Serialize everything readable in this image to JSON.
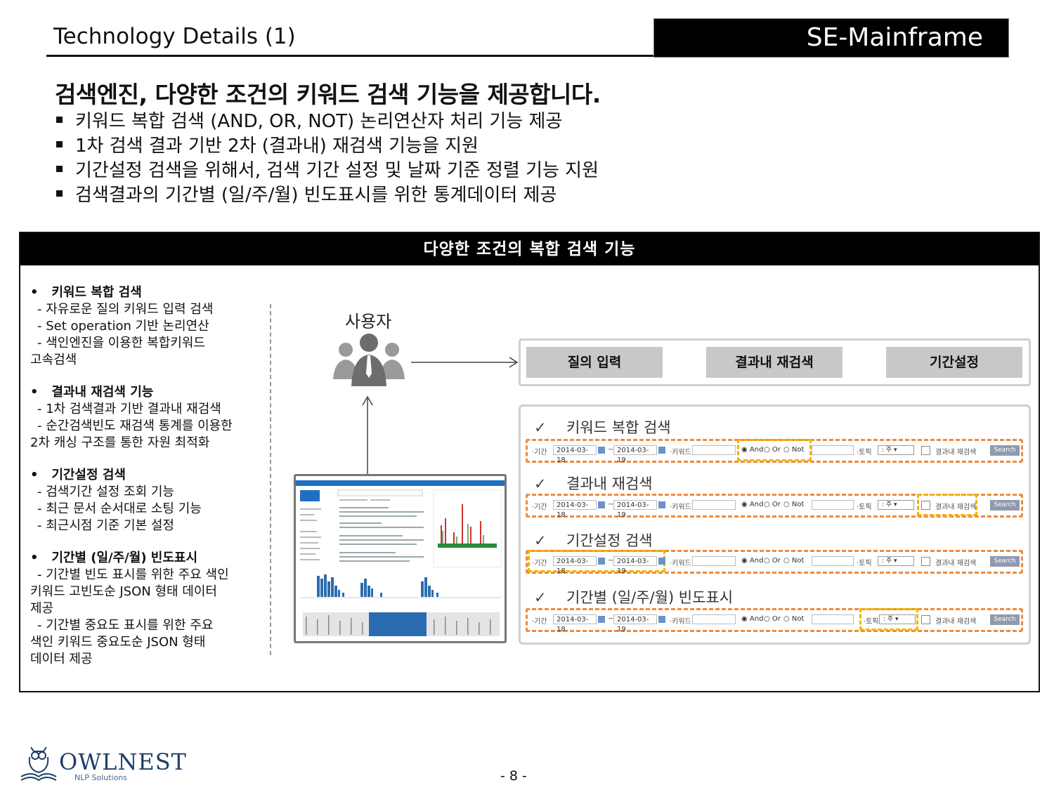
{
  "header": {
    "title": "Technology Details (1)",
    "brand": "SE-Mainframe"
  },
  "headline": "검색엔진, 다양한 조건의 키워드 검색 기능을 제공합니다.",
  "bullets": [
    "키워드 복합 검색 (AND, OR, NOT) 논리연산자 처리 기능 제공",
    "1차 검색 결과 기반 2차 (결과내) 재검색 기능을 지원",
    "기간설정 검색을 위해서, 검색 기간 설정 및 날짜 기준 정렬 기능 지원",
    "검색결과의 기간별 (일/주/월) 빈도표시를 위한 통계데이터 제공"
  ],
  "panel": {
    "title": "다양한 조건의 복합 검색 기능",
    "left": [
      {
        "heading": "키워드 복합 검색",
        "lines": [
          "- 자유로운 질의 키워드 입력 검색",
          "- Set operation 기반 논리연산",
          "- 색인엔진을 이용한 복합키워드",
          "고속검색"
        ]
      },
      {
        "heading": "결과내 재검색 기능",
        "lines": [
          "- 1차 검색결과 기반 결과내 재검색",
          "- 순간검색빈도 재검색 통계를 이용한",
          "2차 캐싱 구조를 통한 자원 최적화"
        ]
      },
      {
        "heading": "기간설정 검색",
        "lines": [
          "- 검색기간 설정 조회 기능",
          "- 최근 문서 순서대로 소팅 기능",
          "- 최근시점 기준 기본 설정"
        ]
      },
      {
        "heading": "기간별 (일/주/월) 빈도표시",
        "lines": [
          "- 기간별 빈도 표시를 위한 주요 색인",
          "키워드 고빈도순 JSON 형태 데이터",
          "제공",
          "- 기간별 중요도 표시를 위한 주요",
          "색인 키워드 중요도순 JSON 형태",
          "데이터 제공"
        ]
      }
    ],
    "user_label": "사용자",
    "stages": [
      "질의 입력",
      "결과내 재검색",
      "기간설정"
    ],
    "features": [
      "키워드 복합 검색",
      "결과내 재검색",
      "기간설정 검색",
      "기간별 (일/주/월) 빈도표시"
    ],
    "check_mark": "✓",
    "search_row": {
      "period_label": "·기간",
      "date_from": "2014-03-18",
      "tilde": "~",
      "date_to": "2014-03-19",
      "keyword_label": "·키워드",
      "and_label": "And",
      "or_label": "Or",
      "not_label": "Not",
      "unit_label": "·토픽",
      "unit_value": "주",
      "rescan_label": "결과내 재검색",
      "search_button": "Search"
    }
  },
  "footer": {
    "page": "- 8 -",
    "logo": "OWLNEST",
    "logo_sub": "NLP Solutions"
  },
  "colors": {
    "accent_orange": "#f08a3c",
    "accent_yellow": "#f0b400",
    "stage_gray": "#c8c8c8"
  }
}
